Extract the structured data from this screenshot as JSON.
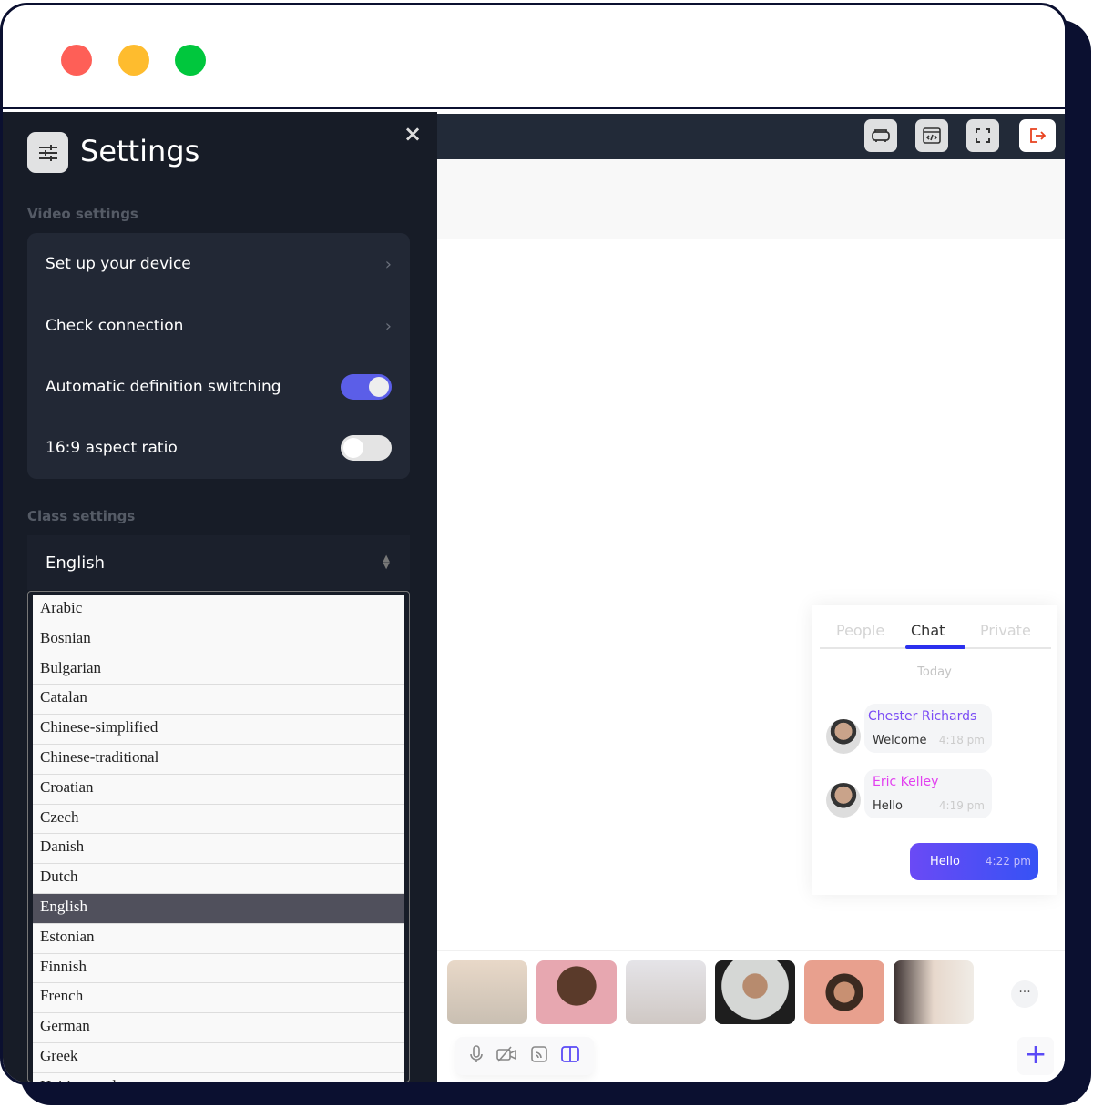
{
  "window": {
    "controls": [
      "close",
      "minimize",
      "maximize"
    ],
    "colors": {
      "close": "#fe5f57",
      "minimize": "#febc2e",
      "maximize": "#00c73d"
    }
  },
  "settings": {
    "title": "Settings",
    "close_label": "×",
    "video_section": "Video settings",
    "video_items": [
      {
        "label": "Set up your device",
        "type": "link"
      },
      {
        "label": "Check connection",
        "type": "link"
      },
      {
        "label": "Automatic definition switching",
        "type": "toggle",
        "on": true
      },
      {
        "label": "16:9 aspect ratio",
        "type": "toggle",
        "on": false
      }
    ],
    "class_section": "Class settings",
    "language": {
      "selected": "English",
      "options": [
        "Arabic",
        "Bosnian",
        "Bulgarian",
        "Catalan",
        "Chinese-simplified",
        "Chinese-traditional",
        "Croatian",
        "Czech",
        "Danish",
        "Dutch",
        "English",
        "Estonian",
        "Finnish",
        "French",
        "German",
        "Greek",
        "Haitiancreole"
      ]
    },
    "toggle_on_color": "#5b5ee8"
  },
  "toolbar": {
    "icons": [
      "sofa-icon",
      "code-window-icon",
      "fullscreen-icon",
      "exit-icon"
    ]
  },
  "chat": {
    "tabs": [
      "People",
      "Chat",
      "Private"
    ],
    "active_tab": "Chat",
    "day": "Today",
    "messages": [
      {
        "name": "Chester Richards",
        "text": "Welcome",
        "time": "4:18 pm",
        "color": "#7a4cf5"
      },
      {
        "name": "Eric Kelley",
        "text": "Hello",
        "time": "4:19 pm",
        "color": "#e23ff0"
      }
    ],
    "own": {
      "text": "Hello",
      "time": "4:22 pm"
    }
  },
  "participants": {
    "more_label": "···"
  },
  "controls": {
    "icons": [
      "microphone-icon",
      "camera-off-icon",
      "cast-icon",
      "layout-icon"
    ],
    "add_label": "+"
  }
}
